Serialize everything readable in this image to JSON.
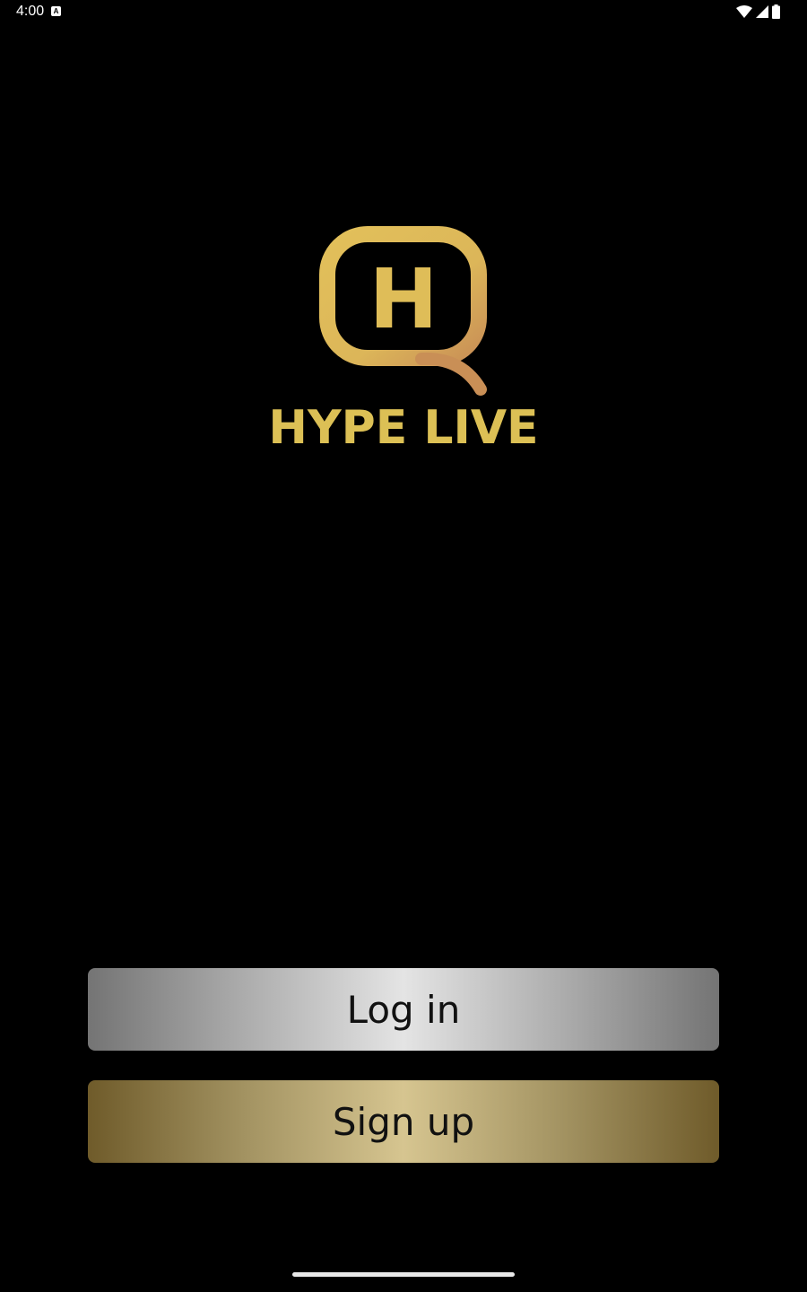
{
  "status_bar": {
    "time": "4:00",
    "notification_icon": "a-icon",
    "icons": [
      "wifi-icon",
      "cellular-signal-icon",
      "battery-icon"
    ]
  },
  "brand": {
    "logo_letter": "H",
    "app_name": "HYPE LIVE",
    "gold_color": "#e2bf57",
    "copper_color": "#c98f56"
  },
  "actions": {
    "login_label": "Log in",
    "signup_label": "Sign up"
  },
  "colors": {
    "background": "#000000",
    "login_button_center": "#e4e4e4",
    "signup_button_center": "#d6c590"
  }
}
